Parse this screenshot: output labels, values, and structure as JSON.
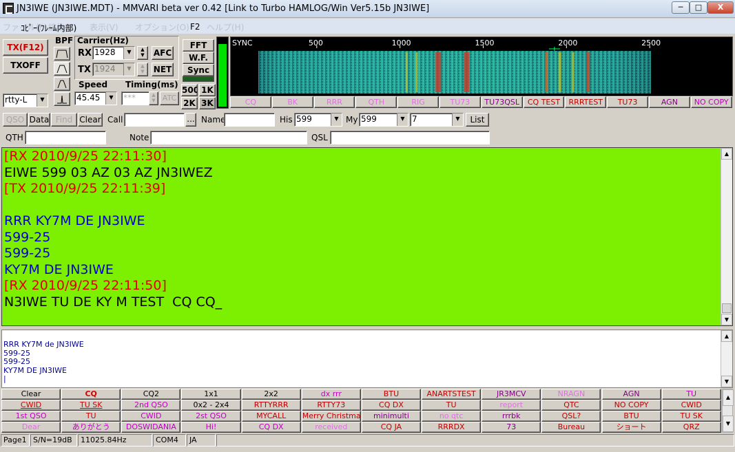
{
  "window": {
    "title": "JN3IWE (JN3IWE.MDT) - MMVARI beta ver 0.42 [Link to Turbo HAMLOG/Win Ver5.15b JN3IWE]",
    "min_glyph": "─",
    "max_glyph": "□",
    "close_glyph": "X"
  },
  "menu": {
    "items": [
      "ファイル(F)",
      "編集(E)",
      "表示(V)",
      "オプション(O)",
      "ヘルプ(H)"
    ],
    "popup_text": "ｺﾋﾟｰ(ﾌﾚｰﾑ内部)",
    "popup_shortcut": "F2"
  },
  "left_controls": {
    "tx_label": "TX(F12)",
    "txoff_label": "TXOFF",
    "mode_value": "rtty-L",
    "bpf_label": "BPF"
  },
  "carrier": {
    "title": "Carrier(Hz)",
    "rx_label": "RX",
    "tx_label": "TX",
    "rx_value": "1928",
    "tx_value": "1924",
    "afc_label": "AFC",
    "net_label": "NET",
    "spin_up": "▲",
    "spin_down": "▼"
  },
  "speed": {
    "title": "Speed",
    "value": "45.45",
    "timing_title": "Timing(ms)",
    "timing_value": "***",
    "atc_label": "ATC"
  },
  "display_mode": {
    "fft_label": "FFT",
    "wf_label": "W.F.",
    "sync_label": "Sync",
    "bw_500": "500",
    "bw_1k": "1K",
    "bw_2k": "2K",
    "bw_3k": "3K"
  },
  "level_meter": {
    "level": 0.92
  },
  "waterfall": {
    "sync_label": "SYNC",
    "freq_labels": [
      "500",
      "1000",
      "1500",
      "2000",
      "2500"
    ],
    "freq_values": [
      500,
      1000,
      1500,
      2000,
      2500
    ],
    "marker_freq": 1928
  },
  "top_macros": [
    {
      "label": "CQ",
      "color": "#e070e0"
    },
    {
      "label": "BK",
      "color": "#e070e0"
    },
    {
      "label": "RRR",
      "color": "#e070e0"
    },
    {
      "label": "QTH",
      "color": "#e070e0"
    },
    {
      "label": "RIG",
      "color": "#e070e0"
    },
    {
      "label": "TU73",
      "color": "#e070e0"
    },
    {
      "label": "TU73QSL",
      "color": "#800080"
    },
    {
      "label": "CQ TEST",
      "color": "#c00000"
    },
    {
      "label": "RRRTEST",
      "color": "#c00000"
    },
    {
      "label": "TU73",
      "color": "#c00000"
    },
    {
      "label": "AGN",
      "color": "#800080"
    },
    {
      "label": "NO COPY",
      "color": "#c000c0"
    }
  ],
  "log_row": {
    "qso_label": "QSO",
    "data_label": "Data",
    "find_label": "Find",
    "clear_label": "Clear",
    "call_label": "Call",
    "call_value": "",
    "more_label": "...",
    "name_label": "Name",
    "name_value": "",
    "his_label": "His",
    "his_value": "599",
    "my_label": "My",
    "my_value": "599",
    "band_value": "7",
    "list_label": "List",
    "qth_label": "QTH",
    "qth_value": "",
    "note_label": "Note",
    "note_value": "",
    "qsl_label": "QSL",
    "qsl_value": ""
  },
  "rx_text": [
    {
      "text": "[RX 2010/9/25 22:11:30]",
      "style": "red"
    },
    {
      "text": "EIWE 599 03 AZ 03 AZ JN3IWEZ",
      "style": "black"
    },
    {
      "text": "[TX 2010/9/25 22:11:39]",
      "style": "red"
    },
    {
      "text": "",
      "style": "black"
    },
    {
      "text": "RRR KY7M DE JN3IWE",
      "style": "blue"
    },
    {
      "text": "599-25",
      "style": "blue"
    },
    {
      "text": "599-25",
      "style": "blue"
    },
    {
      "text": "KY7M DE JN3IWE",
      "style": "blue"
    },
    {
      "text": "[RX 2010/9/25 22:11:50]",
      "style": "red"
    },
    {
      "text": "N3IWE TU DE KY M TEST  CQ CQ_",
      "style": "black"
    }
  ],
  "tx_text": [
    "RRR KY7M de JN3IWE",
    "599-25",
    "599-25",
    "KY7M DE JN3IWE",
    "|"
  ],
  "macro_grid": [
    [
      {
        "label": "Clear",
        "color": "#000000",
        "u": false,
        "b": false
      },
      {
        "label": "CQ",
        "color": "#d00000",
        "u": false,
        "b": true
      },
      {
        "label": "CQ2",
        "color": "#000000",
        "u": false,
        "b": false
      },
      {
        "label": "1x1",
        "color": "#000000",
        "u": false,
        "b": false
      },
      {
        "label": "2x2",
        "color": "#000000",
        "u": false,
        "b": false
      },
      {
        "label": "dx rrr",
        "color": "#c000c0",
        "u": false,
        "b": false
      },
      {
        "label": "BTU",
        "color": "#c00000",
        "u": false,
        "b": false
      },
      {
        "label": "ANARTSTEST",
        "color": "#c00000",
        "u": false,
        "b": false
      },
      {
        "label": "JR3MCV",
        "color": "#800080",
        "u": false,
        "b": false
      },
      {
        "label": "NRAGN",
        "color": "#e070e0",
        "u": false,
        "b": false
      },
      {
        "label": "AGN",
        "color": "#800080",
        "u": false,
        "b": false
      },
      {
        "label": "TU",
        "color": "#c000c0",
        "u": false,
        "b": false
      }
    ],
    [
      {
        "label": "CWID",
        "color": "#d00000",
        "u": true,
        "b": false
      },
      {
        "label": "TU SK",
        "color": "#d00000",
        "u": true,
        "b": false
      },
      {
        "label": "2nd QSO",
        "color": "#c000c0",
        "u": false,
        "b": false
      },
      {
        "label": "0x2 - 2x4",
        "color": "#000000",
        "u": false,
        "b": false
      },
      {
        "label": "RTTYRRR",
        "color": "#c00000",
        "u": false,
        "b": false
      },
      {
        "label": "RTTY73",
        "color": "#c00000",
        "u": false,
        "b": false
      },
      {
        "label": "CQ DX",
        "color": "#c00000",
        "u": false,
        "b": false
      },
      {
        "label": "TU",
        "color": "#c00000",
        "u": false,
        "b": false
      },
      {
        "label": "report",
        "color": "#e070e0",
        "u": false,
        "b": false
      },
      {
        "label": "QTC",
        "color": "#c00000",
        "u": false,
        "b": false
      },
      {
        "label": "NO COPY",
        "color": "#c00000",
        "u": false,
        "b": false
      },
      {
        "label": "CWID",
        "color": "#c00000",
        "u": false,
        "b": false
      }
    ],
    [
      {
        "label": "1st QSO",
        "color": "#c000c0",
        "u": false,
        "b": false
      },
      {
        "label": "TU",
        "color": "#d00000",
        "u": false,
        "b": false
      },
      {
        "label": "CWID",
        "color": "#c000c0",
        "u": false,
        "b": false
      },
      {
        "label": "2st QSO",
        "color": "#c000c0",
        "u": false,
        "b": false
      },
      {
        "label": "MYCALL",
        "color": "#c00000",
        "u": false,
        "b": false
      },
      {
        "label": "Merry Christmas",
        "color": "#c00000",
        "u": false,
        "b": false
      },
      {
        "label": "minimulti",
        "color": "#800080",
        "u": false,
        "b": false
      },
      {
        "label": "no qtc",
        "color": "#e070e0",
        "u": false,
        "b": false
      },
      {
        "label": "rrrbk",
        "color": "#800080",
        "u": false,
        "b": false
      },
      {
        "label": "QSL?",
        "color": "#c00000",
        "u": false,
        "b": false
      },
      {
        "label": "BTU",
        "color": "#c00000",
        "u": false,
        "b": false
      },
      {
        "label": "TU SK",
        "color": "#c00000",
        "u": false,
        "b": false
      }
    ],
    [
      {
        "label": "Dear",
        "color": "#e070e0",
        "u": false,
        "b": false
      },
      {
        "label": "ありがとう",
        "color": "#c000c0",
        "u": false,
        "b": false
      },
      {
        "label": "DOSWIDANIA",
        "color": "#c000c0",
        "u": false,
        "b": false
      },
      {
        "label": "Hi!",
        "color": "#c000c0",
        "u": false,
        "b": false
      },
      {
        "label": "CQ DX",
        "color": "#c000c0",
        "u": false,
        "b": false
      },
      {
        "label": "received",
        "color": "#e070e0",
        "u": false,
        "b": false
      },
      {
        "label": "CQ JA",
        "color": "#c00000",
        "u": false,
        "b": false
      },
      {
        "label": "RRRDX",
        "color": "#c00000",
        "u": false,
        "b": false
      },
      {
        "label": "73",
        "color": "#800080",
        "u": false,
        "b": false
      },
      {
        "label": "Bureau",
        "color": "#c00000",
        "u": false,
        "b": false
      },
      {
        "label": "ショート",
        "color": "#c00000",
        "u": false,
        "b": false
      },
      {
        "label": "QRZ",
        "color": "#c00000",
        "u": false,
        "b": false
      }
    ]
  ],
  "status": {
    "page": "Page1",
    "sn": "S/N=19dB",
    "clock": "11025.84Hz",
    "port": "COM4",
    "lang": "JA"
  },
  "colors": {
    "rx_background": "#7cf000",
    "rx_red": "#e00000",
    "rx_blue": "#0000c8"
  }
}
